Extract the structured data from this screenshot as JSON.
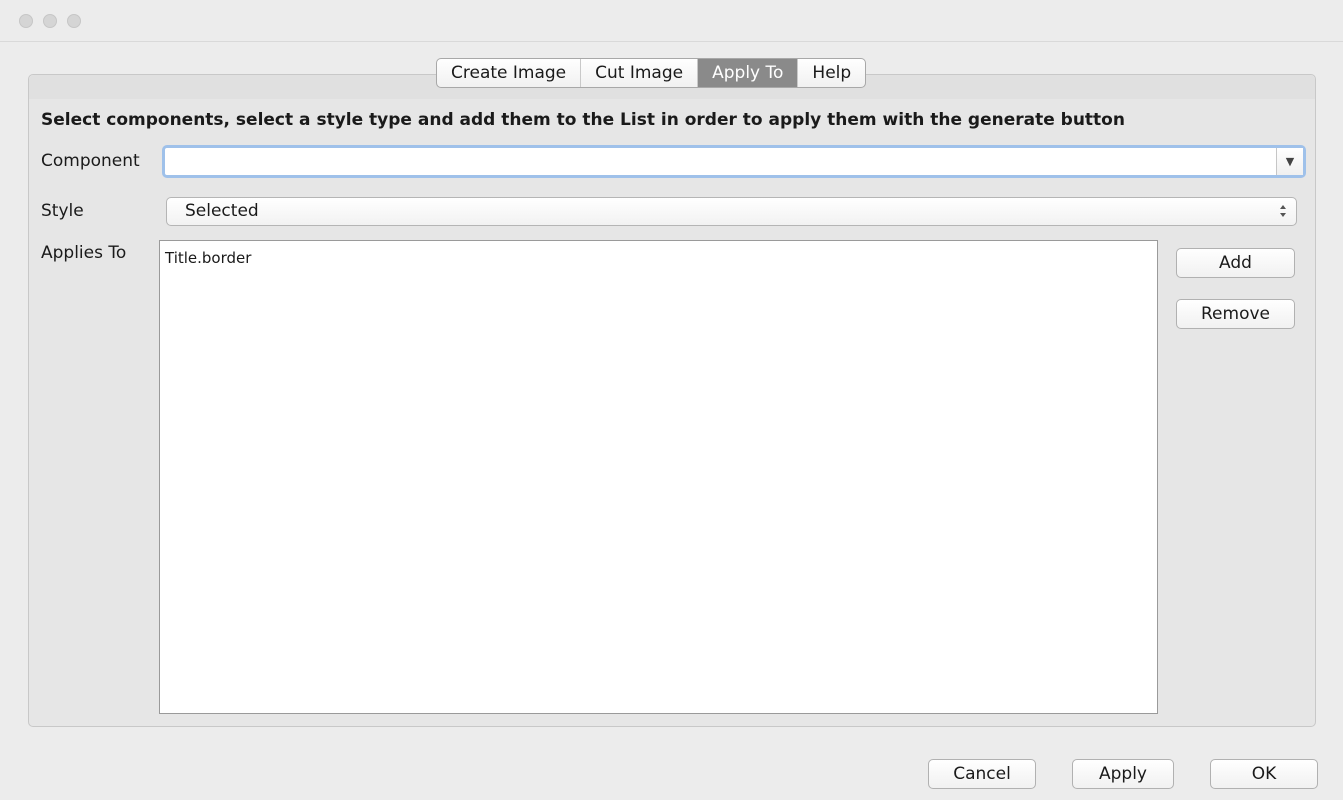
{
  "tabs": [
    "Create Image",
    "Cut Image",
    "Apply To",
    "Help"
  ],
  "active_tab": "Apply To",
  "instruction": "Select components, select a style type and add them to the List in order to apply them with the generate button",
  "form": {
    "component_label": "Component",
    "component_value": "",
    "style_label": "Style",
    "style_value": "Selected",
    "applies_to_label": "Applies To"
  },
  "applies_to_items": [
    "Title.border"
  ],
  "buttons": {
    "add": "Add",
    "remove": "Remove",
    "cancel": "Cancel",
    "apply": "Apply",
    "ok": "OK"
  },
  "icons": {
    "combo_arrow": "triangle-down-icon",
    "select_arrows": "updown-arrows-icon"
  }
}
